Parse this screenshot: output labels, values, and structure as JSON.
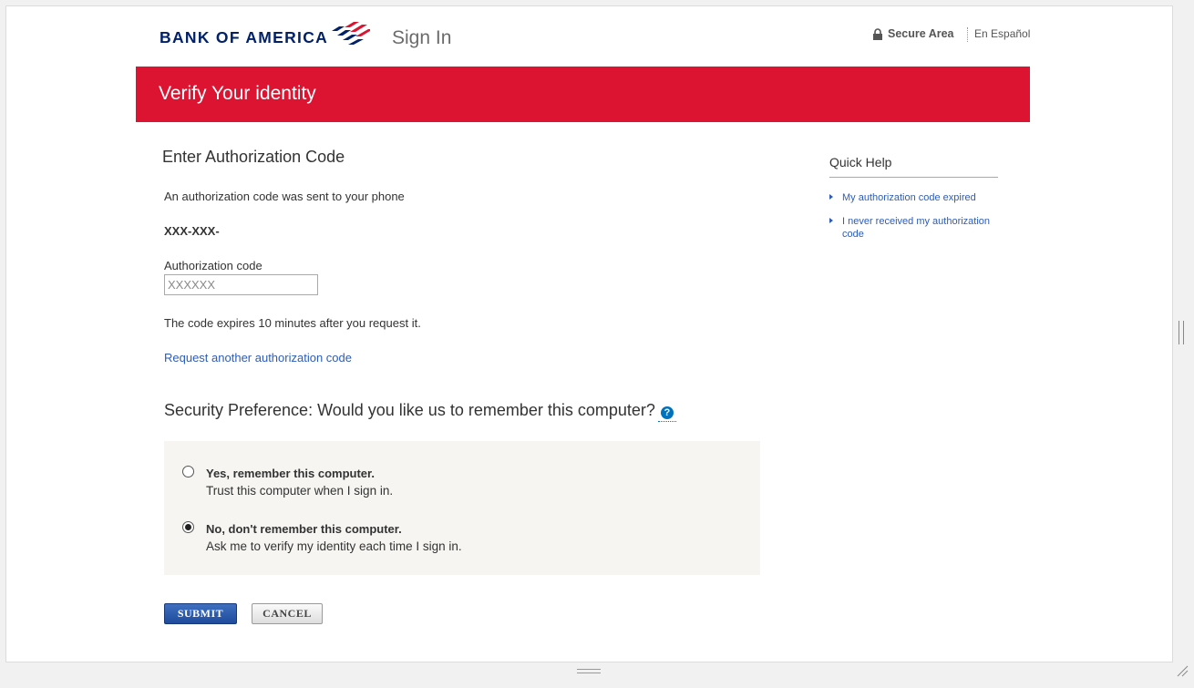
{
  "header": {
    "logo_text": "BANK OF AMERICA",
    "page_title": "Sign In",
    "secure_area": "Secure Area",
    "language_link": "En Español",
    "brand_colors": {
      "navy": "#012169",
      "red": "#dc1431"
    }
  },
  "banner": {
    "title": "Verify Your identity"
  },
  "main": {
    "heading": "Enter Authorization Code",
    "sent_message": "An authorization code was sent to your phone",
    "phone_masked": "XXX-XXX-",
    "auth_label": "Authorization code",
    "auth_placeholder": "XXXXXX",
    "auth_value": "",
    "expire_message": "The code expires 10 minutes after you request it.",
    "request_link": "Request another authorization code",
    "security_question": "Security Preference: Would you like us to remember this computer?",
    "help_icon_glyph": "?",
    "options": [
      {
        "title": "Yes, remember this computer.",
        "subtitle": "Trust this computer when I sign in.",
        "selected": false
      },
      {
        "title": "No, don't remember this computer.",
        "subtitle": "Ask me to verify my identity each time I sign in.",
        "selected": true
      }
    ],
    "submit_label": "SUBMIT",
    "cancel_label": "CANCEL"
  },
  "quick_help": {
    "title": "Quick Help",
    "items": [
      {
        "label": "My authorization code expired"
      },
      {
        "label": "I never received my authorization code"
      }
    ]
  }
}
